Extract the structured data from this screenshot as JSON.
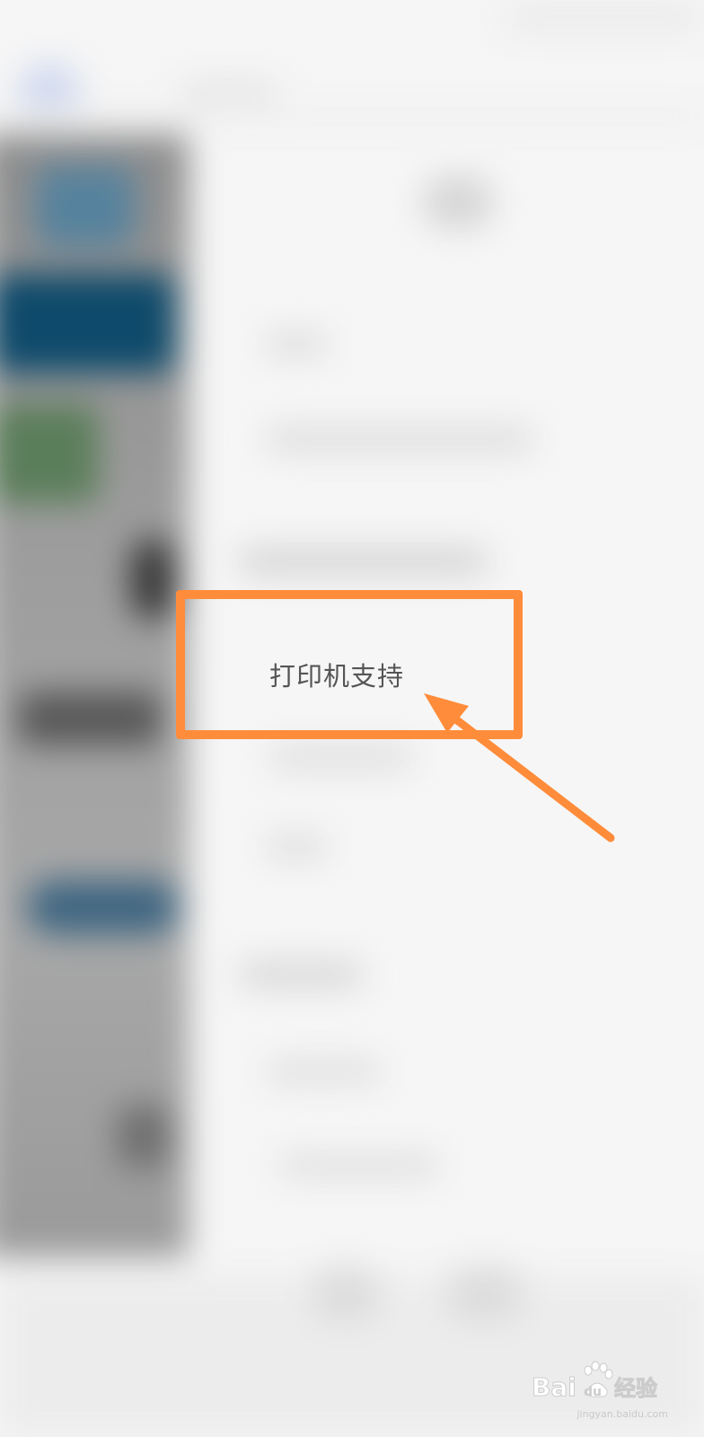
{
  "screen": {
    "menu_item_label": "打印机支持"
  },
  "annotation": {
    "color": "#ff8c3a"
  },
  "watermark": {
    "brand": "Baidu经验",
    "url": "jingyan.baidu.com"
  },
  "icons": {
    "arrow": "arrow-pointer-icon"
  }
}
